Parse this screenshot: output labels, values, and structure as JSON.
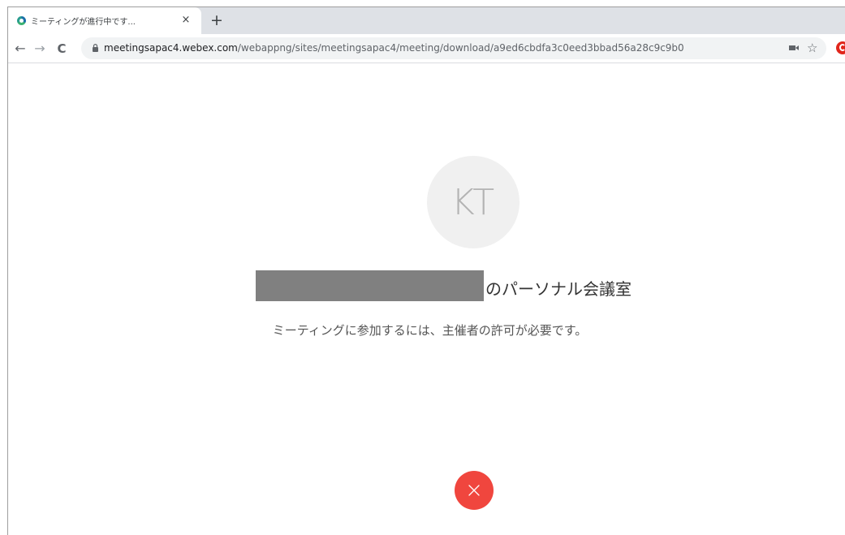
{
  "browser": {
    "tab": {
      "favicon": "webex-globe-icon",
      "title": "ミーティングが進行中です...",
      "close_icon": "×"
    },
    "new_tab_icon": "+",
    "toolbar": {
      "back_icon": "←",
      "forward_icon": "→",
      "reload_icon": "C",
      "url_host": "meetingsapac4.webex.com",
      "url_path": "/webappng/sites/meetingsapac4/meeting/download/a9ed6cbdfa3c0eed3bbad56a28c9c9b0",
      "bookmark_icon": "☆"
    }
  },
  "meeting": {
    "avatar_initials": "KT",
    "room_title": "のパーソナル会議室",
    "message": "ミーティングに参加するには、主催者の許可が必要です。",
    "leave_button_icon": "close-icon"
  },
  "colors": {
    "leave_button": "#f0463e",
    "avatar_bg": "#f0f0f0",
    "redaction": "#808080"
  }
}
